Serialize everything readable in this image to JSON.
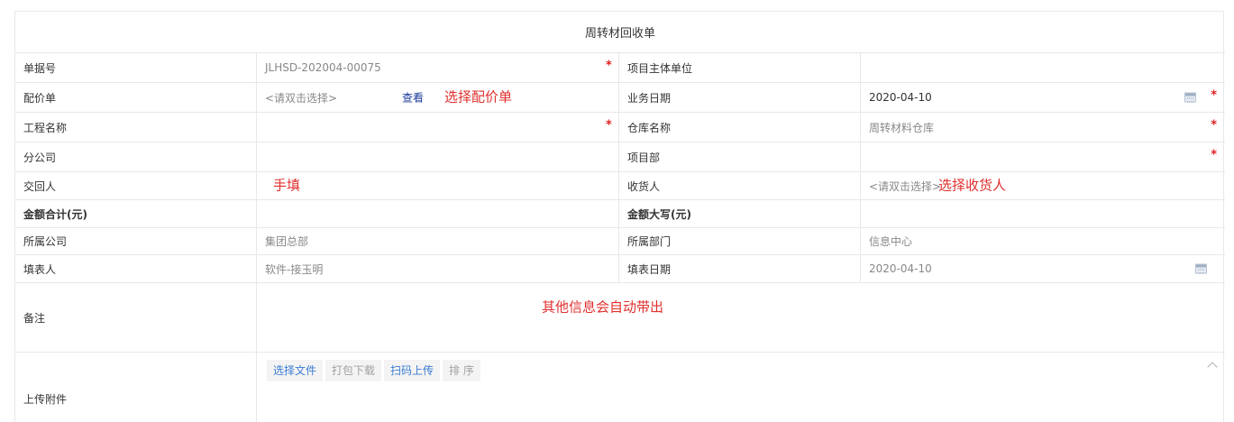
{
  "form_title": "周转材回收单",
  "rows": {
    "r1": {
      "label1": "单据号",
      "value1": "JLHSD-202004-00075",
      "req1": "*",
      "label2": "项目主体单位",
      "value2": ""
    },
    "r2": {
      "label1": "配价单",
      "value1": "<请双击选择>",
      "view_link": "查看",
      "note1": "选择配价单",
      "label2": "业务日期",
      "value2": "2020-04-10",
      "req2": "*"
    },
    "r3": {
      "label1": "工程名称",
      "value1": "",
      "req1": "*",
      "label2": "仓库名称",
      "value2": "周转材料仓库",
      "req2": "*"
    },
    "r4": {
      "label1": "分公司",
      "value1": "",
      "label2": "项目部",
      "value2": "",
      "req2": "*"
    },
    "r5": {
      "label1": "交回人",
      "note1": "手填",
      "label2": "收货人",
      "value2": "<请双击选择>",
      "note2": "选择收货人"
    },
    "r6": {
      "label1": "金额合计(元)",
      "value1": "",
      "label2": "金额大写(元)",
      "value2": ""
    },
    "r7": {
      "label1": "所属公司",
      "value1": "集团总部",
      "label2": "所属部门",
      "value2": "信息中心"
    },
    "r8": {
      "label1": "填表人",
      "value1": "软件-接玉明",
      "label2": "填表日期",
      "value2": "2020-04-10"
    },
    "r9": {
      "label1": "备注",
      "note": "其他信息会自动带出"
    },
    "r10": {
      "label1": "上传附件"
    }
  },
  "attachments": {
    "choose_file": "选择文件",
    "pack_download": "打包下载",
    "scan_upload": "扫码上传",
    "sort": "排 序"
  },
  "colors": {
    "required": "#e02020",
    "annotation": "#e0302e",
    "link": "#1a3a9c",
    "button_blue": "#3a7bd5"
  },
  "icons": [
    "calendar-icon",
    "chevron-up-icon"
  ]
}
